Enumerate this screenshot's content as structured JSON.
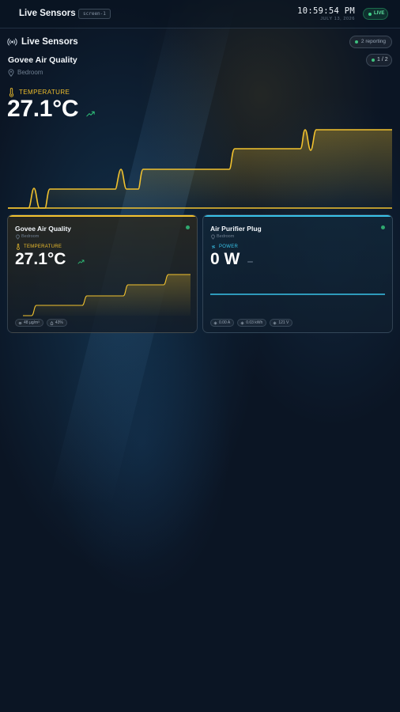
{
  "app": {
    "title": "Live Sensors",
    "screen_tag": "screen-1"
  },
  "header": {
    "clock": "10:59:54 PM",
    "date": "JULY 13, 2026",
    "live_label": "LIVE"
  },
  "hero": {
    "section_title": "Live Sensors",
    "reporting": "2 reporting",
    "device": "Govee Air Quality",
    "location": "Bedroom",
    "page": "1 / 2",
    "metric": "TEMPERATURE",
    "value": "27.1°C",
    "trend": "up",
    "accent": "#f2c22e"
  },
  "cards": [
    {
      "device": "Govee Air Quality",
      "location": "Bedroom",
      "metric": "TEMPERATURE",
      "value": "27.1°C",
      "trend": "up",
      "accent": "#f2c22e",
      "status": "online",
      "chips": [
        {
          "icon": "particulate-icon",
          "text": "48 µg/m³"
        },
        {
          "icon": "humidity-icon",
          "text": "43%"
        }
      ]
    },
    {
      "device": "Air Purifier Plug",
      "location": "Bedroom",
      "metric": "POWER",
      "value": "0 W",
      "trend": "flat",
      "accent": "#38c2e8",
      "status": "online",
      "chips": [
        {
          "icon": "bolt-icon",
          "text": "0.00 A"
        },
        {
          "icon": "bolt-icon",
          "text": "0.03 kWh"
        },
        {
          "icon": "bolt-icon",
          "text": "121 V"
        }
      ]
    }
  ],
  "colors": {
    "online": "#2fa86f",
    "trend_up": "#2fc27a",
    "temperature": "#f2c22e",
    "power": "#38c2e8"
  }
}
